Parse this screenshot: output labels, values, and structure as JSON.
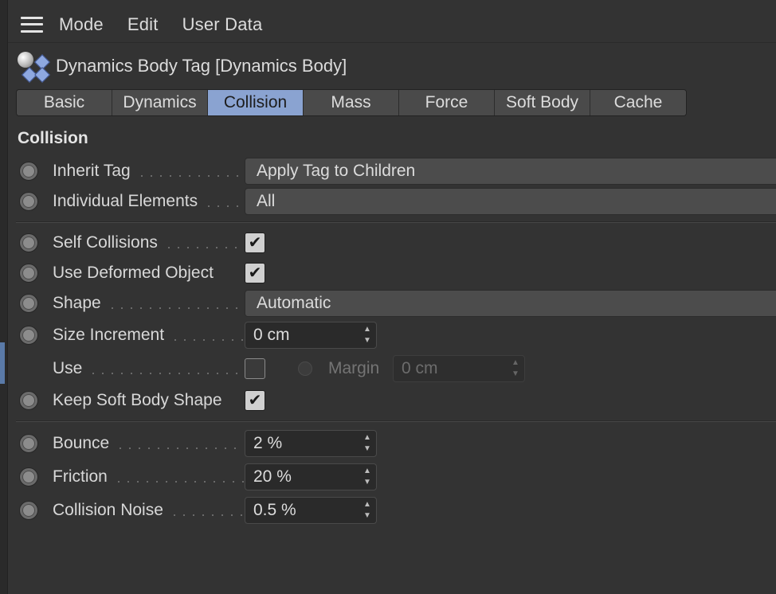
{
  "menubar": {
    "items": [
      "Mode",
      "Edit",
      "User Data"
    ]
  },
  "titlebar": {
    "title": "Dynamics Body Tag [Dynamics Body]"
  },
  "tabs": [
    {
      "label": "Basic",
      "active": false
    },
    {
      "label": "Dynamics",
      "active": false
    },
    {
      "label": "Collision",
      "active": true
    },
    {
      "label": "Mass",
      "active": false
    },
    {
      "label": "Force",
      "active": false
    },
    {
      "label": "Soft Body",
      "active": false
    },
    {
      "label": "Cache",
      "active": false
    }
  ],
  "section": {
    "title": "Collision"
  },
  "fields": {
    "inherit_tag": {
      "label": "Inherit Tag",
      "value": "Apply Tag to Children"
    },
    "individual_elements": {
      "label": "Individual Elements",
      "value": "All"
    },
    "self_collisions": {
      "label": "Self Collisions",
      "checked": true
    },
    "use_deformed_object": {
      "label": "Use Deformed Object",
      "checked": true
    },
    "shape": {
      "label": "Shape",
      "value": "Automatic"
    },
    "size_increment": {
      "label": "Size Increment",
      "value": "0 cm"
    },
    "use": {
      "label": "Use",
      "checked": false
    },
    "margin": {
      "label": "Margin",
      "value": "0 cm"
    },
    "keep_soft_body_shape": {
      "label": "Keep Soft Body Shape",
      "checked": true
    },
    "bounce": {
      "label": "Bounce",
      "value": "2 %"
    },
    "friction": {
      "label": "Friction",
      "value": "20 %"
    },
    "collision_noise": {
      "label": "Collision Noise",
      "value": "0.5 %"
    }
  },
  "glyphs": {
    "check": "✔",
    "spin_up": "▲",
    "spin_down": "▼"
  },
  "colors": {
    "active_tab": "#8aa3d1",
    "panel_bg": "#333333"
  }
}
